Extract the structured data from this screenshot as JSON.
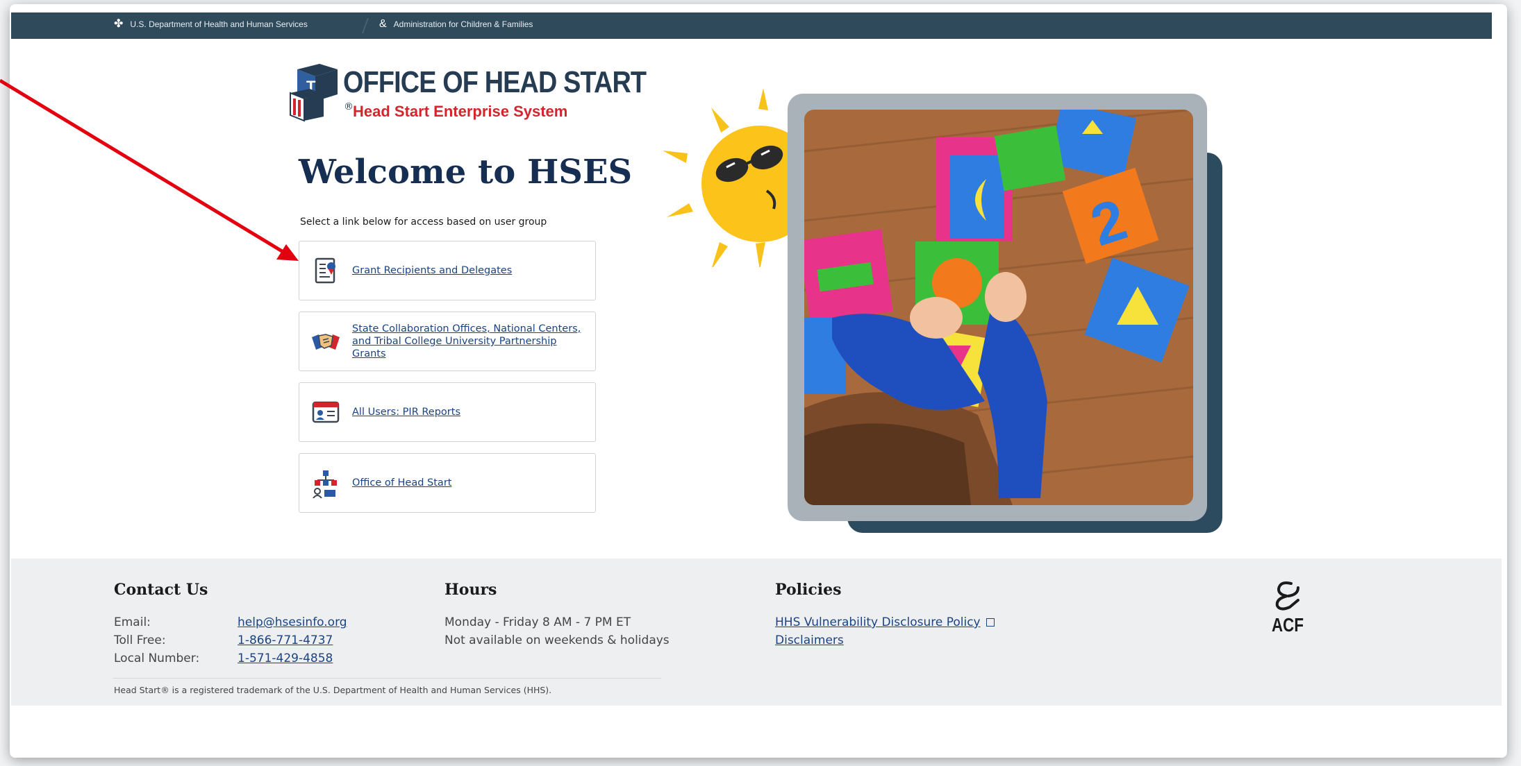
{
  "topbar": {
    "hhs_label": "U.S. Department of Health and Human Services",
    "acf_label": "Administration for Children & Families"
  },
  "logo": {
    "title": "OFFICE OF HEAD START",
    "subtitle": "Head Start Enterprise System",
    "registered_mark": "®"
  },
  "main": {
    "heading": "Welcome to HSES",
    "subtitle": "Select a link below for access based on user group",
    "links": [
      {
        "label": "Grant Recipients and Delegates",
        "icon": "document-certificate-icon"
      },
      {
        "label": "State Collaboration Offices, National Centers, and Tribal College University Partnership Grants",
        "icon": "handshake-icon"
      },
      {
        "label": "All Users: PIR Reports",
        "icon": "report-id-card-icon"
      },
      {
        "label": "Office of Head Start",
        "icon": "organization-people-icon"
      }
    ]
  },
  "footer": {
    "contact": {
      "title": "Contact Us",
      "email_label": "Email:",
      "email": "help@hsesinfo.org",
      "tollfree_label": "Toll Free:",
      "tollfree": "1-866-771-4737",
      "local_label": "Local Number:",
      "local": "1-571-429-4858"
    },
    "hours": {
      "title": "Hours",
      "line1": "Monday - Friday 8 AM - 7 PM ET",
      "line2": "Not available on weekends & holidays"
    },
    "policies": {
      "title": "Policies",
      "link1": "HHS Vulnerability Disclosure Policy",
      "link2": "Disclaimers"
    },
    "acf_logo_text": "ACF",
    "trademark": "Head Start® is a registered trademark of the U.S. Department of Health and Human Services (HHS)."
  },
  "colors": {
    "topbar": "#2f4a5b",
    "heading": "#162e51",
    "link": "#1a4480",
    "brand_red": "#d3262c",
    "photo_shadow": "#2d4b5e",
    "annotation_arrow": "#e3000f"
  }
}
